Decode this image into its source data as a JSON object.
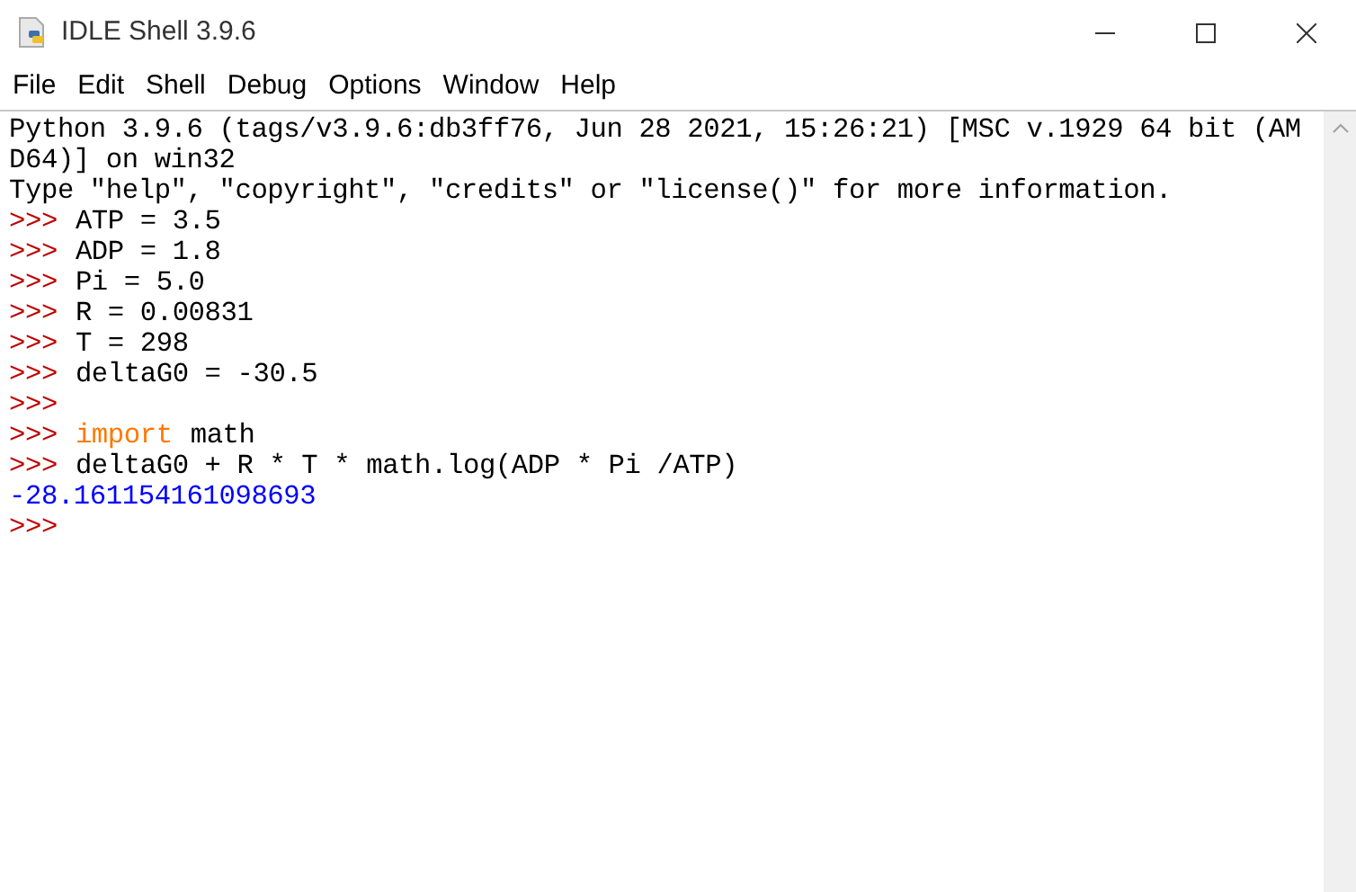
{
  "window": {
    "title": "IDLE Shell 3.9.6"
  },
  "menu": [
    "File",
    "Edit",
    "Shell",
    "Debug",
    "Options",
    "Window",
    "Help"
  ],
  "lines": [
    {
      "kind": "banner",
      "text": "Python 3.9.6 (tags/v3.9.6:db3ff76, Jun 28 2021, 15:26:21) [MSC v.1929 64 bit (AM"
    },
    {
      "kind": "banner",
      "text": "D64)] on win32"
    },
    {
      "kind": "banner",
      "text": "Type \"help\", \"copyright\", \"credits\" or \"license()\" for more information."
    },
    {
      "kind": "input",
      "prompt": ">>>",
      "code": [
        {
          "kind": "plain",
          "text": "ATP = 3.5"
        }
      ]
    },
    {
      "kind": "input",
      "prompt": ">>>",
      "code": [
        {
          "kind": "plain",
          "text": "ADP = 1.8"
        }
      ]
    },
    {
      "kind": "input",
      "prompt": ">>>",
      "code": [
        {
          "kind": "plain",
          "text": "Pi = 5.0"
        }
      ]
    },
    {
      "kind": "input",
      "prompt": ">>>",
      "code": [
        {
          "kind": "plain",
          "text": "R = 0.00831"
        }
      ]
    },
    {
      "kind": "input",
      "prompt": ">>>",
      "code": [
        {
          "kind": "plain",
          "text": "T = 298"
        }
      ]
    },
    {
      "kind": "input",
      "prompt": ">>>",
      "code": [
        {
          "kind": "plain",
          "text": "deltaG0 = -30.5"
        }
      ]
    },
    {
      "kind": "input",
      "prompt": ">>>"
    },
    {
      "kind": "input",
      "prompt": ">>>",
      "code": [
        {
          "kind": "keyword",
          "text": "import"
        },
        {
          "kind": "plain",
          "text": "math"
        }
      ]
    },
    {
      "kind": "input",
      "prompt": ">>>",
      "code": [
        {
          "kind": "plain",
          "text": "deltaG0 + R * T * math.log(ADP * Pi /ATP)"
        }
      ]
    },
    {
      "kind": "result",
      "text": "-28.161154161098693"
    },
    {
      "kind": "input",
      "prompt": ">>>"
    }
  ]
}
